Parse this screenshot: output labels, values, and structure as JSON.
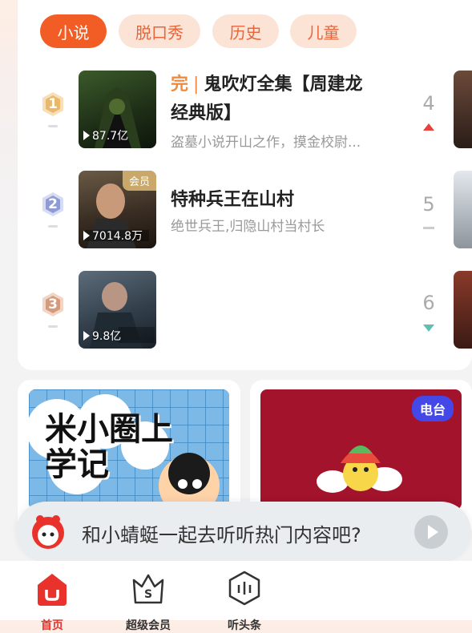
{
  "tabs": [
    {
      "label": "小说",
      "active": true
    },
    {
      "label": "脱口秀",
      "active": false
    },
    {
      "label": "历史",
      "active": false
    },
    {
      "label": "儿童",
      "active": false
    }
  ],
  "ranking": [
    {
      "rank": "1",
      "status": "完",
      "title_line1": "鬼吹灯全集【周建龙",
      "title_line2": "经典版】",
      "desc": "盗墓小说开山之作，摸金校尉...",
      "plays": "87.7亿",
      "vip": "",
      "next_rank": "4",
      "trend": "up"
    },
    {
      "rank": "2",
      "status": "",
      "title_line1": "特种兵王在山村",
      "title_line2": "",
      "desc": "绝世兵王,归隐山村当村长",
      "plays": "7014.8万",
      "vip": "会员",
      "next_rank": "5",
      "trend": "flat"
    },
    {
      "rank": "3",
      "status": "",
      "title_line1": "",
      "title_line2": "",
      "desc": "",
      "plays": "9.8亿",
      "vip": "",
      "next_rank": "6",
      "trend": "down"
    }
  ],
  "cards": {
    "left_cover_text": "米小圈上学记",
    "right_badge": "电台"
  },
  "prompt": {
    "text": "和小蜻蜓一起去听听热门内容吧?"
  },
  "nav": [
    {
      "label": "首页",
      "icon": "home-icon"
    },
    {
      "label": "超级会员",
      "icon": "vip-crown-icon"
    },
    {
      "label": "听头条",
      "icon": "audio-headline-icon"
    }
  ],
  "colors": {
    "accent": "#f15d25",
    "trend_up": "#e8413e",
    "trend_down": "#5fc0b2",
    "radio_badge": "#4448e6"
  }
}
